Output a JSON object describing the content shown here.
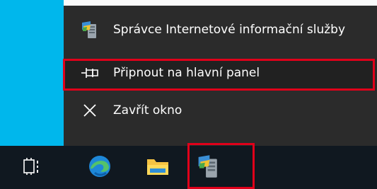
{
  "jumplist": {
    "items": [
      {
        "label": "Správce Internetové informační služby",
        "icon": "iis-manager-icon"
      },
      {
        "label": "Připnout na hlavní panel",
        "icon": "pin-icon"
      },
      {
        "label": "Zavřít okno",
        "icon": "close-icon"
      }
    ]
  },
  "taskbar": {
    "buttons": [
      {
        "icon": "task-view-icon"
      },
      {
        "icon": "edge-icon"
      },
      {
        "icon": "file-explorer-icon"
      },
      {
        "icon": "iis-manager-icon"
      }
    ]
  },
  "colors": {
    "highlight": "#e0001a",
    "jumplist_bg": "#2b2b2b",
    "taskbar_bg": "#101820",
    "desktop": "#00b7ec"
  }
}
